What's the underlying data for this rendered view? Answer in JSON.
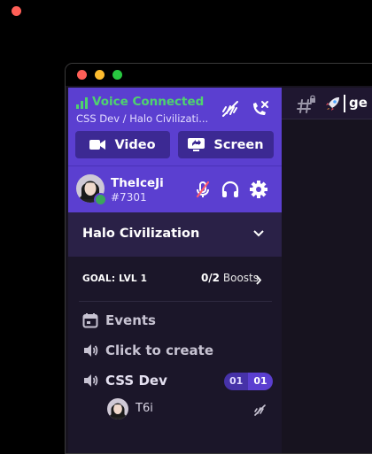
{
  "voice": {
    "status": "Voice Connected",
    "channel_path": "CSS Dev / Halo Civilizati...",
    "video_label": "Video",
    "screen_label": "Screen"
  },
  "user": {
    "name": "TheIceJi",
    "tag": "#7301"
  },
  "server": {
    "name": "Halo Civilization"
  },
  "boost": {
    "goal": "GOAL: LVL 1",
    "count": "0/2",
    "label": "Boosts"
  },
  "channels": [
    {
      "label": "Events",
      "icon": "calendar-icon"
    },
    {
      "label": "Click to create",
      "icon": "speaker-icon"
    },
    {
      "label": "CSS Dev",
      "icon": "speaker-icon",
      "badge_left": "01",
      "badge_right": "01"
    }
  ],
  "members": [
    {
      "name": "T6i"
    }
  ],
  "topbar": {
    "text": "ge"
  },
  "colors": {
    "accent": "#5b3fd0",
    "voice_connected": "#4fd36e",
    "sidebar_bg": "#1b1629"
  }
}
